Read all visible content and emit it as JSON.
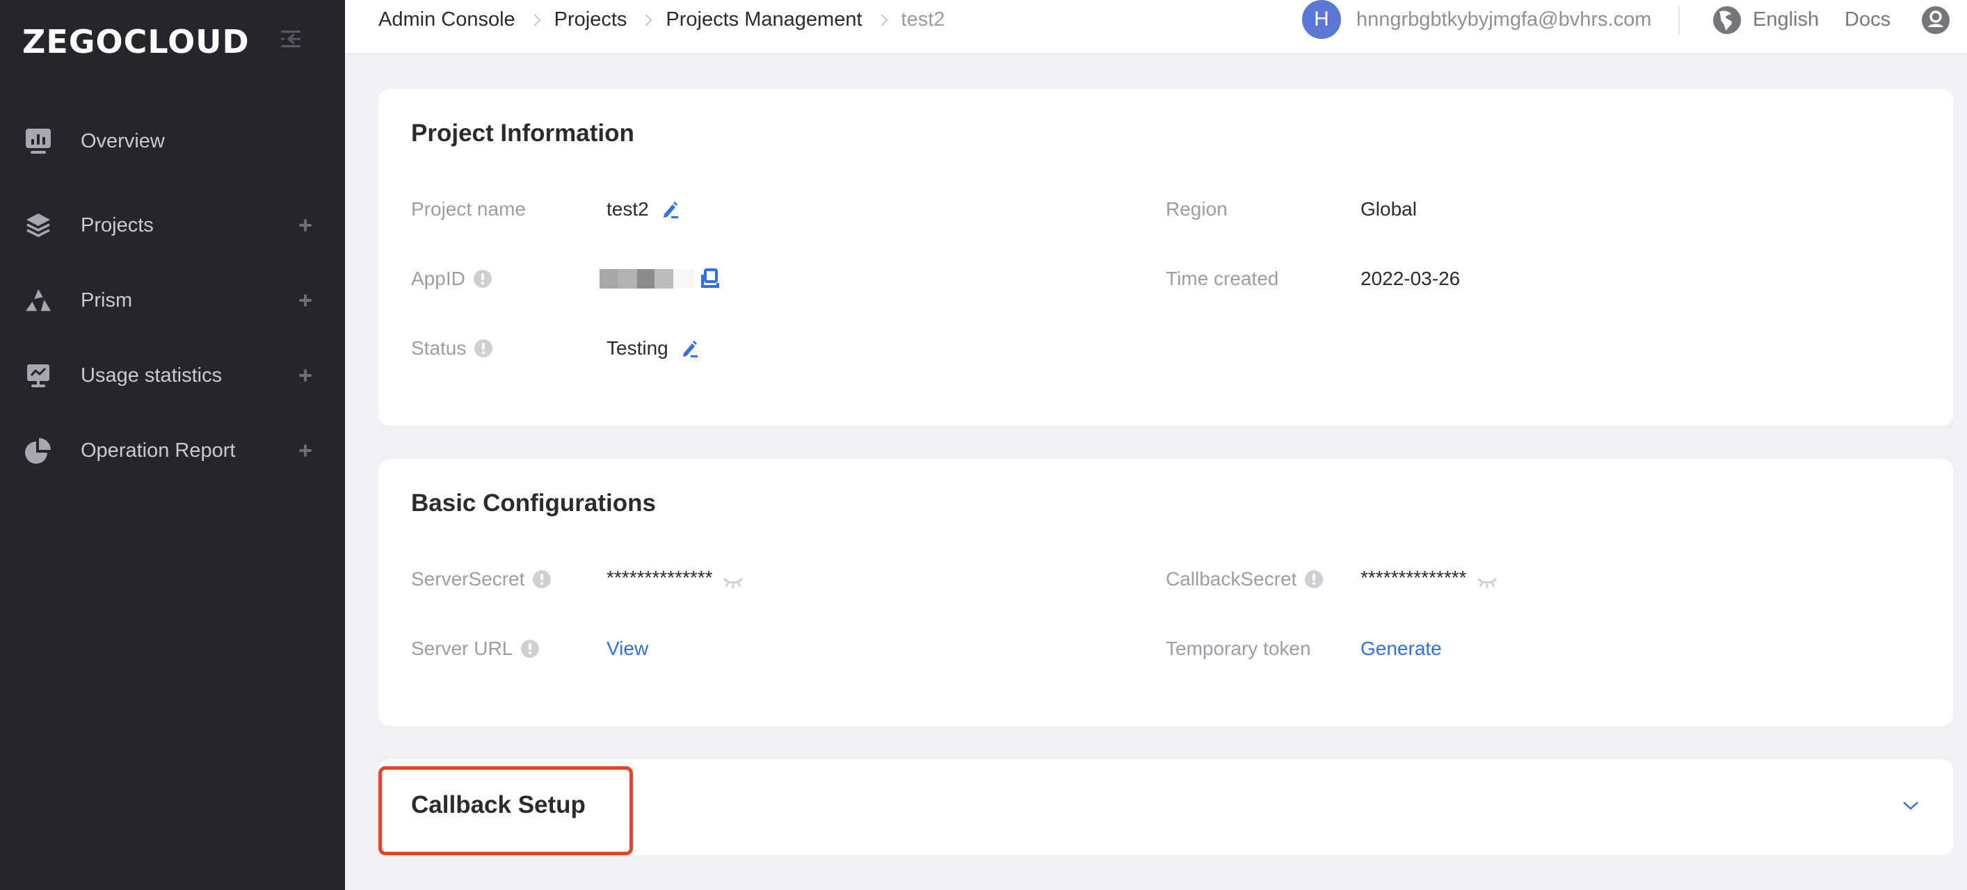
{
  "app": {
    "logo_text": "ZEGOCLOUD"
  },
  "sidebar": {
    "items": [
      {
        "label": "Overview",
        "icon": "dashboard-icon",
        "expandable": false
      },
      {
        "label": "Projects",
        "icon": "layers-icon",
        "expandable": true
      },
      {
        "label": "Prism",
        "icon": "prism-icon",
        "expandable": true
      },
      {
        "label": "Usage statistics",
        "icon": "monitor-chart-icon",
        "expandable": true
      },
      {
        "label": "Operation Report",
        "icon": "pie-chart-icon",
        "expandable": true
      }
    ]
  },
  "header": {
    "breadcrumb": [
      "Admin Console",
      "Projects",
      "Projects Management",
      "test2"
    ],
    "user_initial": "H",
    "user_email": "hnngrbgbtkybyjmgfa@bvhrs.com",
    "language": "English",
    "docs_label": "Docs"
  },
  "project_info": {
    "title": "Project Information",
    "fields": {
      "project_name": {
        "label": "Project name",
        "value": "test2"
      },
      "appid": {
        "label": "AppID",
        "value": "[redacted]"
      },
      "status": {
        "label": "Status",
        "value": "Testing"
      },
      "region": {
        "label": "Region",
        "value": "Global"
      },
      "time_created": {
        "label": "Time created",
        "value": "2022-03-26"
      }
    }
  },
  "basic_config": {
    "title": "Basic Configurations",
    "fields": {
      "server_secret": {
        "label": "ServerSecret",
        "value": "**************"
      },
      "server_url": {
        "label": "Server URL",
        "link": "View"
      },
      "callback_secret": {
        "label": "CallbackSecret",
        "value": "**************"
      },
      "temporary_token": {
        "label": "Temporary token",
        "link": "Generate"
      }
    }
  },
  "callback_setup": {
    "title": "Callback Setup",
    "expanded": false
  },
  "colors": {
    "sidebar_bg": "#25262b",
    "accent_blue": "#2f6fe8",
    "avatar_bg": "#5b78d6",
    "highlight_red": "#e8432a",
    "page_bg": "#f0f1f5"
  }
}
